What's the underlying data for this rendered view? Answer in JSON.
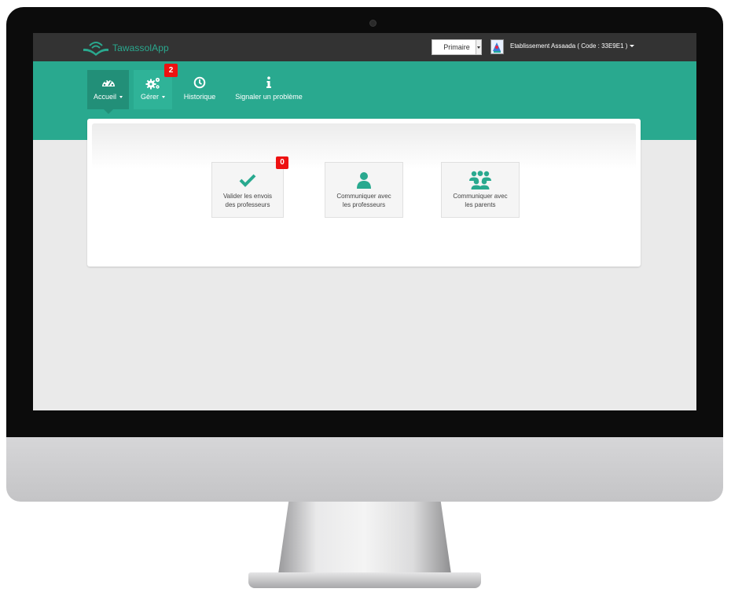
{
  "app": {
    "brand_name": "TawassolApp",
    "brand_color": "#2aa88e",
    "header_bg": "#333333",
    "accent": "#29a98f"
  },
  "navbar": {
    "level_select": {
      "selected": "Primaire"
    },
    "school": {
      "label": "Etablissement Assaada ( Code : 33E9E1 )",
      "avatar_icon": "school-logo-icon"
    }
  },
  "menu": {
    "items": [
      {
        "label": "Accueil",
        "icon": "dashboard-icon",
        "dropdown": true,
        "active": true
      },
      {
        "label": "Gérer",
        "icon": "cogs-icon",
        "dropdown": true,
        "badge": "2"
      },
      {
        "label": "Historique",
        "icon": "clock-icon"
      },
      {
        "label": "Signaler un problème",
        "icon": "info-icon"
      }
    ]
  },
  "dashboard": {
    "tiles": [
      {
        "line1": "Valider les envois",
        "line2": "des professeurs",
        "icon": "check-icon",
        "badge": "0"
      },
      {
        "line1": "Communiquer avec",
        "line2": "les professeurs",
        "icon": "user-icon"
      },
      {
        "line1": "Communiquer avec",
        "line2": "les parents",
        "icon": "users-group-icon"
      }
    ]
  }
}
